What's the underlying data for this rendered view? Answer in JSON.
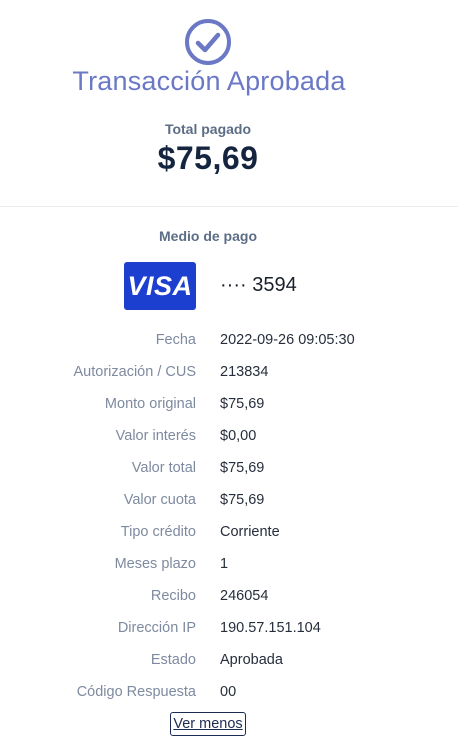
{
  "header": {
    "status_icon": "check-circle-icon",
    "title": "Transacción Aprobada",
    "total_label": "Total pagado",
    "total_amount": "$75,69"
  },
  "payment": {
    "method_label": "Medio de pago",
    "card_brand": "VISA",
    "card_masked": "···· 3594"
  },
  "details": [
    {
      "label": "Fecha",
      "value": "2022-09-26 09:05:30"
    },
    {
      "label": "Autorización / CUS",
      "value": "213834"
    },
    {
      "label": "Monto original",
      "value": "$75,69"
    },
    {
      "label": "Valor interés",
      "value": "$0,00"
    },
    {
      "label": "Valor total",
      "value": "$75,69"
    },
    {
      "label": "Valor cuota",
      "value": "$75,69"
    },
    {
      "label": "Tipo crédito",
      "value": "Corriente"
    },
    {
      "label": "Meses plazo",
      "value": "1"
    },
    {
      "label": "Recibo",
      "value": "246054"
    },
    {
      "label": "Dirección IP",
      "value": "190.57.151.104"
    },
    {
      "label": "Estado",
      "value": "Aprobada"
    },
    {
      "label": "Código Respuesta",
      "value": "00"
    }
  ],
  "toggle_link": "Ver menos",
  "colors": {
    "accent": "#6a78c6",
    "visa_blue": "#1d3fcf",
    "amount": "#15243f",
    "label": "#7e8aa0"
  }
}
